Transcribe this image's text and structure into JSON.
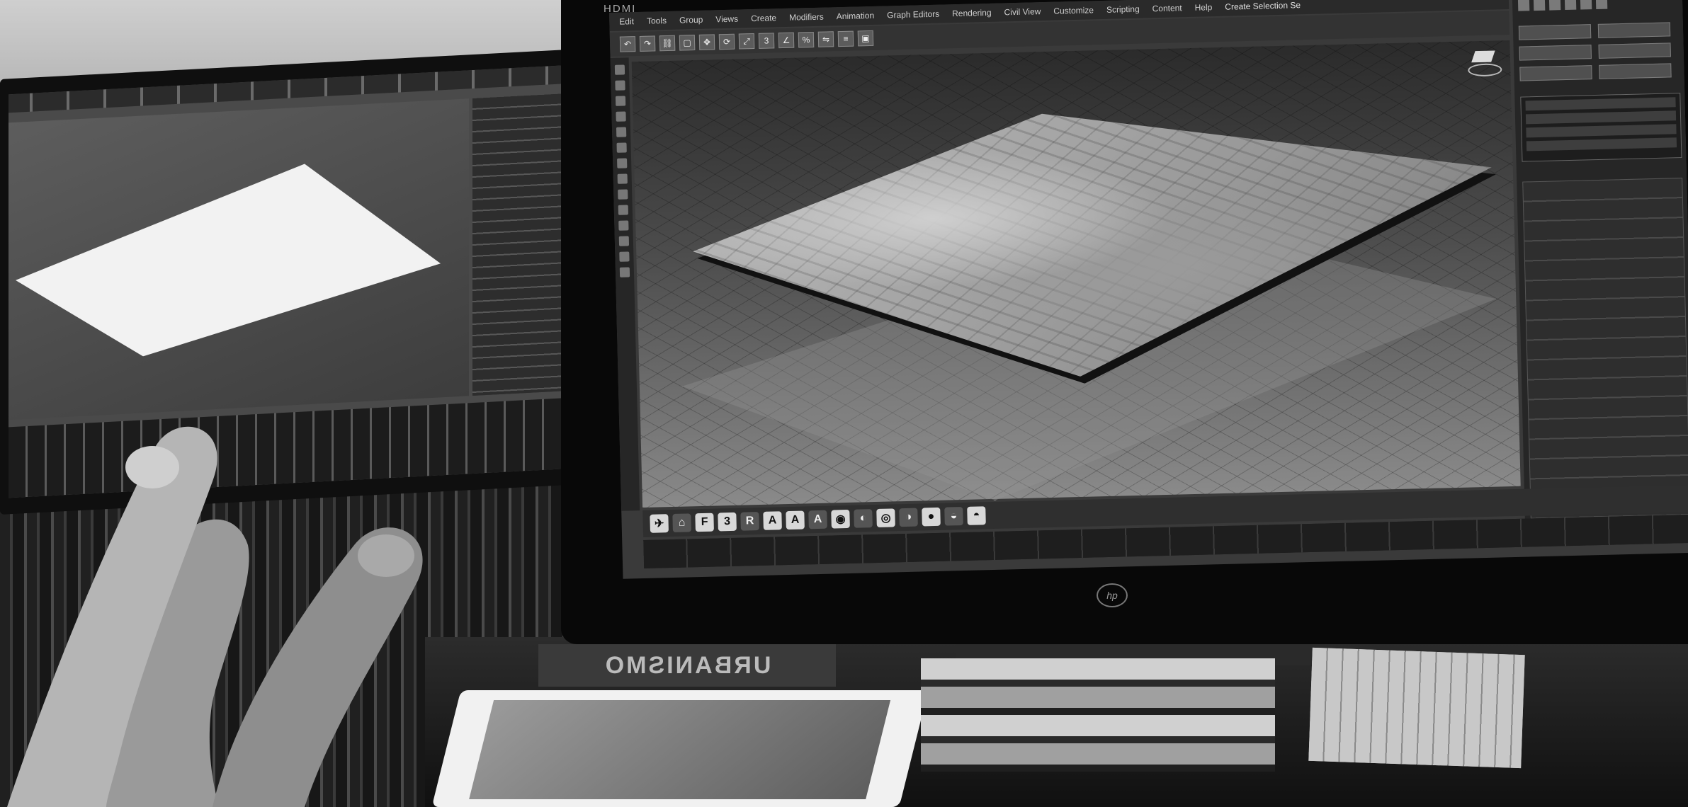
{
  "scene": {
    "description_kind": "photo-of-workstation",
    "colors": {
      "dark": "#080808",
      "screen_bg": "#3a3a3a",
      "mesh_light": "#bdbdbd"
    }
  },
  "main_monitor": {
    "input_label": "HDMI",
    "brand_logo": "hp",
    "menu": [
      "Edit",
      "Tools",
      "Group",
      "Views",
      "Create",
      "Modifiers",
      "Animation",
      "Graph Editors",
      "Rendering",
      "Civil View",
      "Customize",
      "Scripting",
      "Content",
      "Help"
    ],
    "title": "Create Selection Se",
    "shelf_glyphs": [
      "3",
      "R",
      "A",
      "A",
      "A"
    ],
    "icons": [
      "undo-icon",
      "redo-icon",
      "link-icon",
      "select-icon",
      "move-icon",
      "rotate-icon",
      "scale-icon"
    ]
  },
  "book": {
    "spine_text": "URBANISMO"
  }
}
